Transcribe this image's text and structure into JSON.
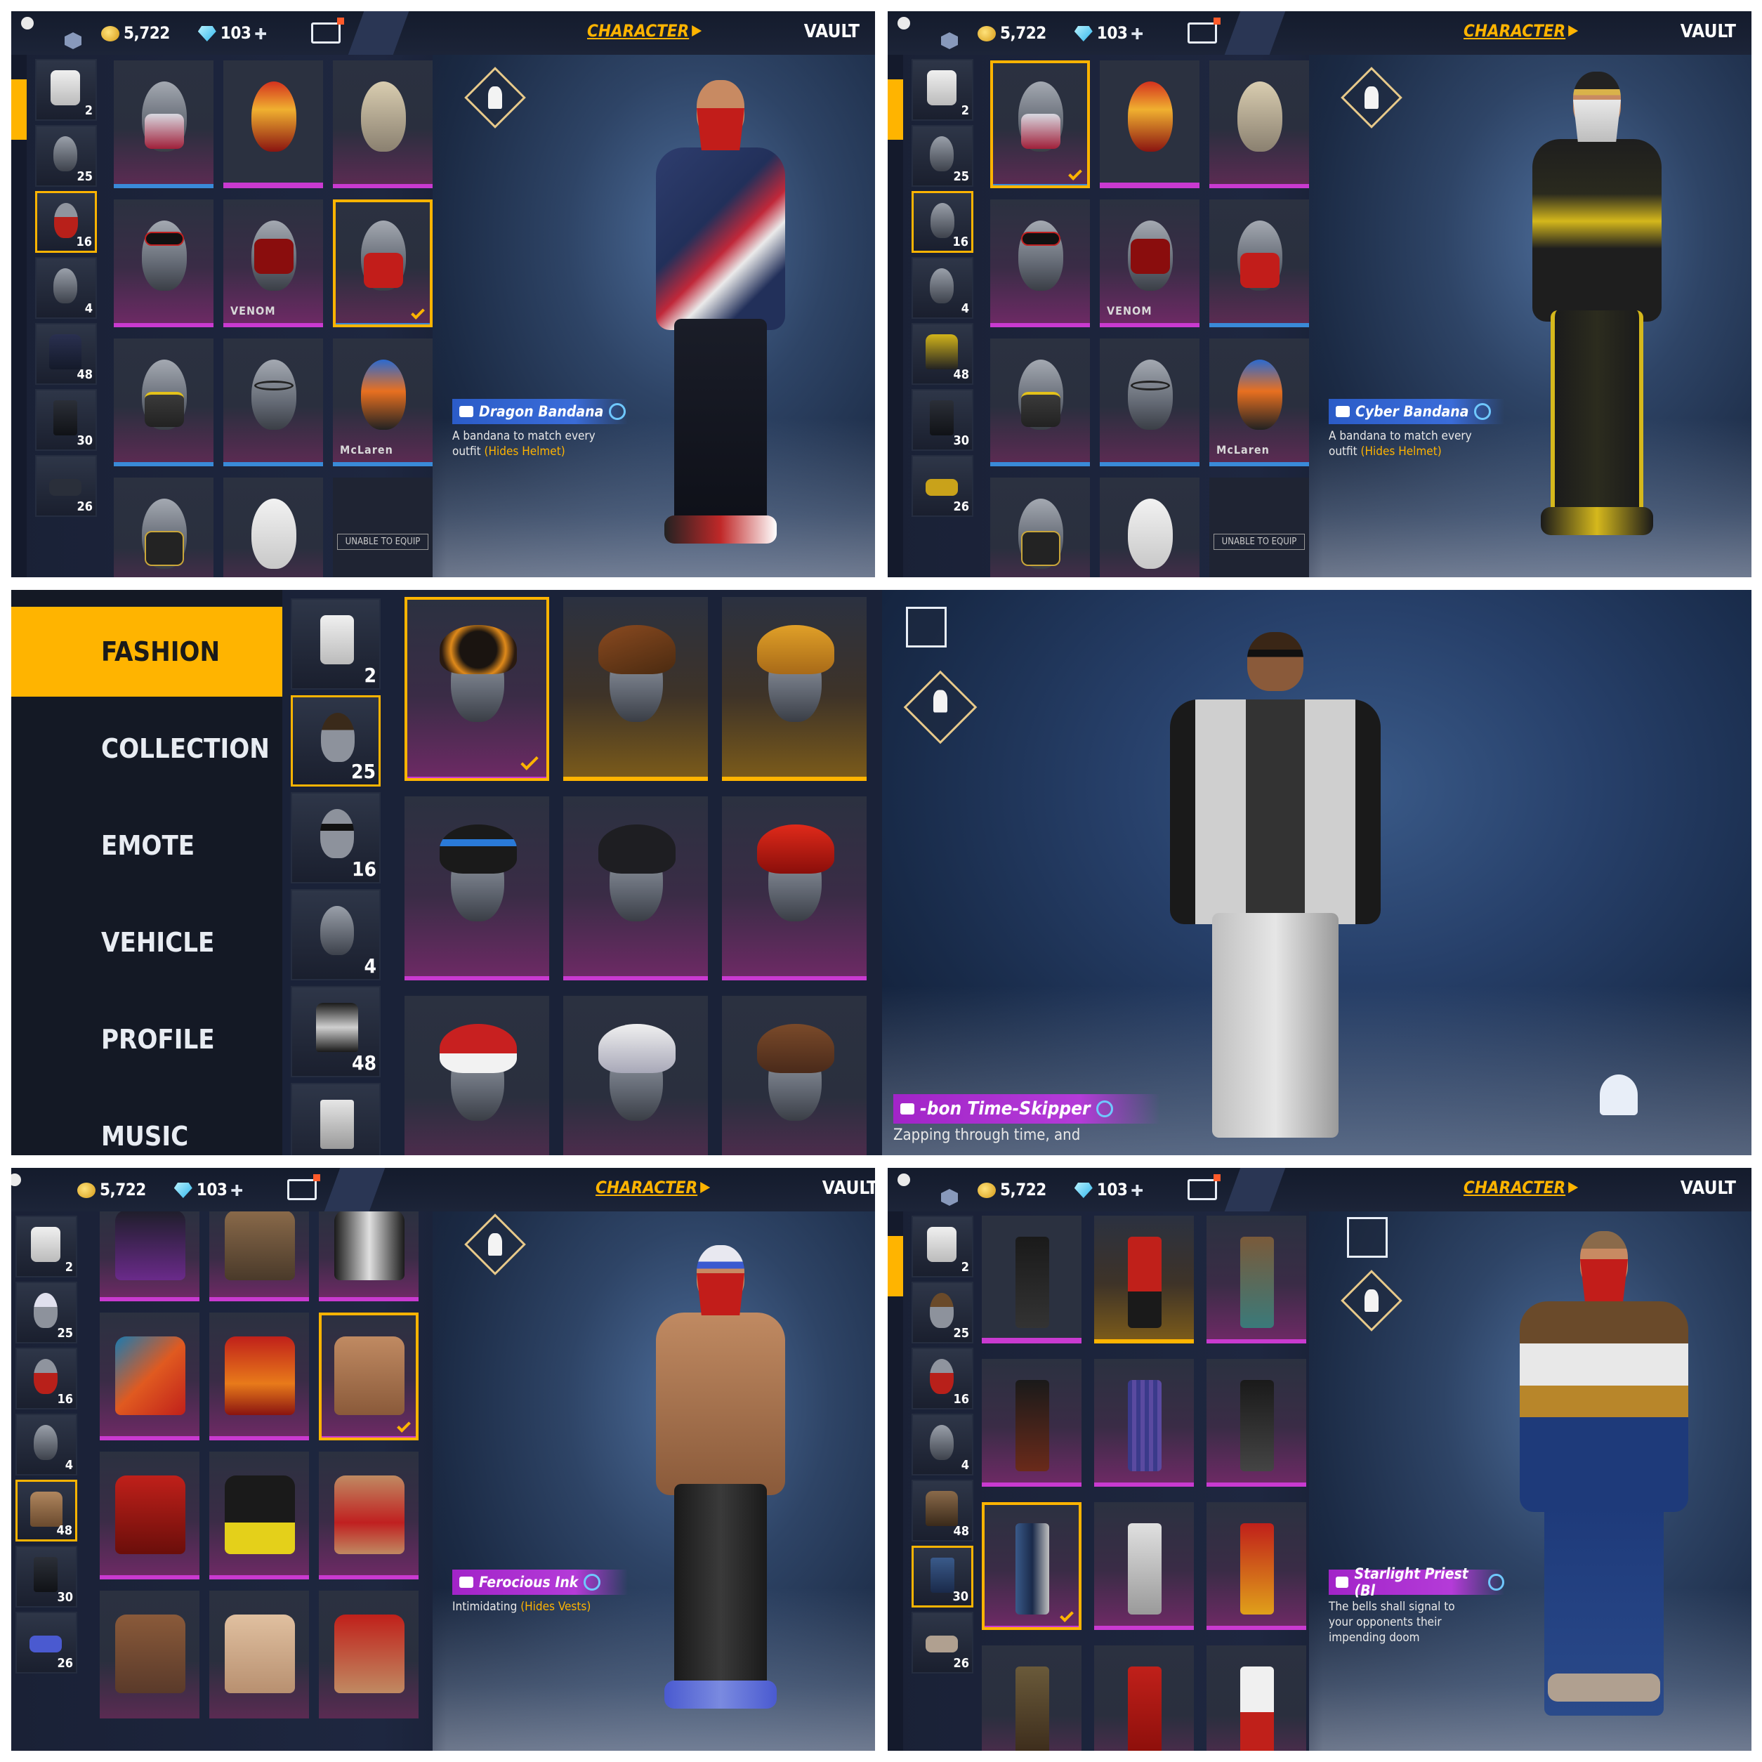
{
  "topbar": {
    "coins": "5,722",
    "gems": "103",
    "character_label": "CHARACTER",
    "vault_label": "VAULT"
  },
  "slot_counts": [
    "2",
    "25",
    "16",
    "4",
    "48",
    "30",
    "26"
  ],
  "panels": {
    "top_left": {
      "item_name": "Dragon Bandana",
      "item_desc": "A bandana to match every outfit",
      "item_note": "(Hides Helmet)",
      "venom_label": "VENOM",
      "mclaren_label": "McLaren",
      "lock_label": "UNABLE TO EQUIP"
    },
    "top_right": {
      "item_name": "Cyber Bandana",
      "item_desc": "A bandana to match every outfit",
      "item_note": "(Hides Helmet)",
      "venom_label": "VENOM",
      "mclaren_label": "McLaren",
      "lock_label": "UNABLE TO EQUIP"
    },
    "middle": {
      "menu": [
        "FASHION",
        "COLLECTION",
        "EMOTE",
        "VEHICLE",
        "PROFILE",
        "MUSIC"
      ],
      "item_name": "-bon Time-Skipper",
      "item_desc": "Zapping through time, and"
    },
    "bottom_left": {
      "item_name": "Ferocious Ink",
      "item_desc": "Intimidating",
      "item_note": "(Hides Vests)"
    },
    "bottom_right": {
      "item_name": "Starlight Priest (Bl",
      "item_desc": "The bells shall signal to your opponents their impending doom"
    }
  },
  "colors": {
    "accent": "#ffb400",
    "rare_blue": "#3a8ad8",
    "epic_purple": "#c93ad0",
    "bandana_red": "#c21d1a"
  },
  "icons": [
    "signal-icon",
    "coin-icon",
    "diamond-icon",
    "plus-icon",
    "pass-icon",
    "store-icon",
    "fashion-icon",
    "wardrobe-icon",
    "gender-icon",
    "checkmark-icon"
  ]
}
